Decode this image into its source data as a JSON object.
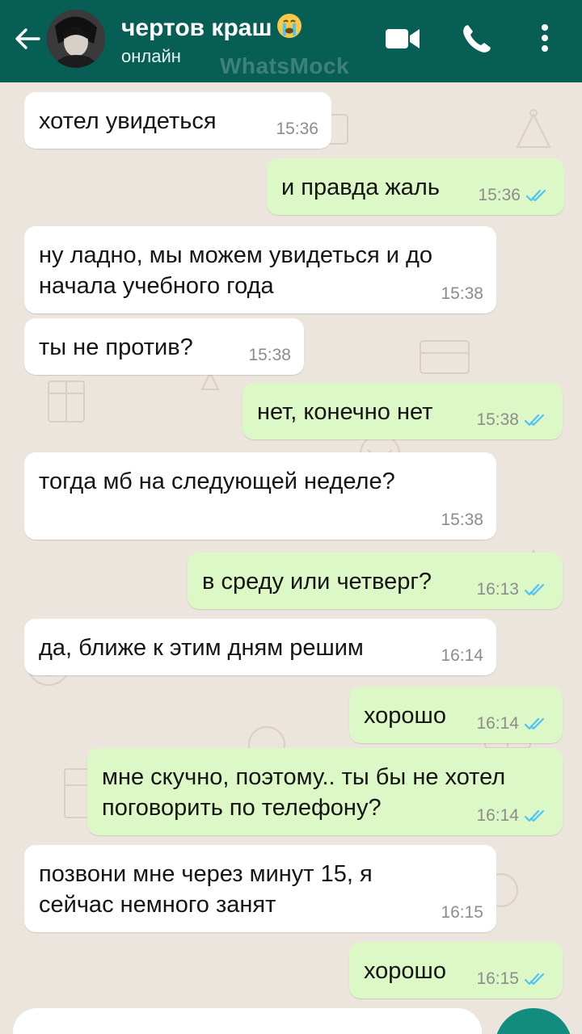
{
  "header": {
    "contact_name": "чертов краш",
    "status": "онлайн",
    "watermark": "WhatsMock",
    "colors": {
      "bar": "#075e54",
      "icon": "#ffffff"
    },
    "icons": [
      "back-arrow-icon",
      "avatar",
      "crying-face-emoji",
      "video-call-icon",
      "phone-icon",
      "more-vertical-icon"
    ]
  },
  "theme": {
    "incoming": "#ffffff",
    "outgoing": "#dcf8c6",
    "read_ticks": "#4fc3f7",
    "time": "#8c8c8c"
  },
  "messages": [
    {
      "dir": "in",
      "text": "хотел увидеться",
      "time": "15:36"
    },
    {
      "dir": "out",
      "text": "и правда жаль",
      "time": "15:36",
      "status": "read"
    },
    {
      "dir": "in",
      "text": "ну ладно, мы можем увидеться и до\nначала учебного года",
      "time": "15:38"
    },
    {
      "dir": "in",
      "text": "ты не против?",
      "time": "15:38"
    },
    {
      "dir": "out",
      "text": "нет, конечно нет",
      "time": "15:38",
      "status": "read"
    },
    {
      "dir": "in",
      "text": "тогда мб на следующей неделе?",
      "time": "15:38"
    },
    {
      "dir": "out",
      "text": "в среду или четверг?",
      "time": "16:13",
      "status": "read"
    },
    {
      "dir": "in",
      "text": "да, ближе к этим дням решим",
      "time": "16:14"
    },
    {
      "dir": "out",
      "text": "хорошо",
      "time": "16:14",
      "status": "read"
    },
    {
      "dir": "out",
      "text": "мне скучно, поэтому.. ты бы не хотел\nпоговорить по телефону?",
      "time": "16:14",
      "status": "read"
    },
    {
      "dir": "in",
      "text": "позвони мне через минут 15, я\nсейчас немного занят",
      "time": "16:15"
    },
    {
      "dir": "out",
      "text": "хорошо",
      "time": "16:15",
      "status": "read"
    }
  ]
}
